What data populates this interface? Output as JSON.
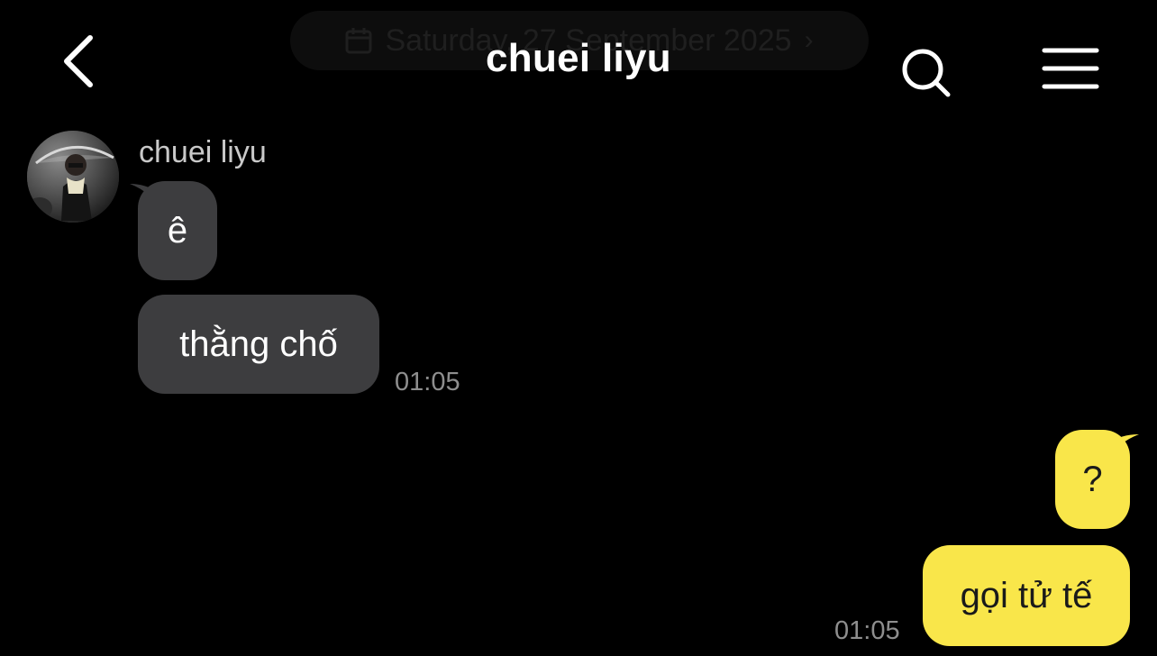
{
  "header": {
    "date_label": "Saturday, 27 September 2025",
    "title": "chuei liyu",
    "back_icon": "chevron-left-icon",
    "search_icon": "search-icon",
    "menu_icon": "hamburger-menu-icon"
  },
  "conversation": {
    "sender_name": "chuei liyu",
    "incoming": [
      {
        "text": "ê"
      },
      {
        "text": "thằng chố",
        "time": "01:05"
      }
    ],
    "outgoing": [
      {
        "text": "?"
      },
      {
        "text": "gọi tử tế",
        "time": "01:05"
      }
    ]
  },
  "colors": {
    "background": "#000000",
    "incoming_bubble": "#3d3d3f",
    "outgoing_bubble": "#f9e64a",
    "timestamp": "#8e8e8e"
  }
}
